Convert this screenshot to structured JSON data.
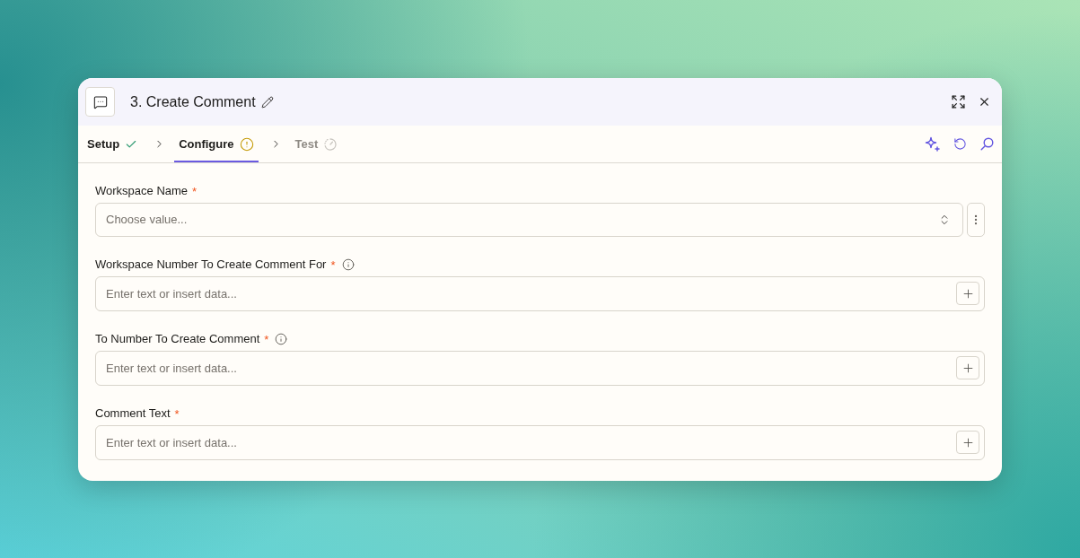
{
  "dialog": {
    "title": "3. Create Comment"
  },
  "steps": [
    {
      "label": "Setup",
      "kind": "done",
      "selected": false
    },
    {
      "label": "Configure",
      "kind": "warning",
      "selected": true
    },
    {
      "label": "Test",
      "kind": "pending",
      "selected": false
    }
  ],
  "fields": [
    {
      "kind": "select",
      "label": "Workspace Name",
      "required_mark": "*",
      "info": false,
      "placeholder": "Choose value..."
    },
    {
      "kind": "text",
      "label": "Workspace Number To Create Comment For",
      "required_mark": "*",
      "info": true,
      "placeholder": "Enter text or insert data..."
    },
    {
      "kind": "text",
      "label": "To Number To Create Comment",
      "required_mark": "*",
      "info": true,
      "placeholder": "Enter text or insert data..."
    },
    {
      "kind": "text",
      "label": "Comment Text",
      "required_mark": "*",
      "info": false,
      "placeholder": "Enter text or insert data..."
    }
  ]
}
